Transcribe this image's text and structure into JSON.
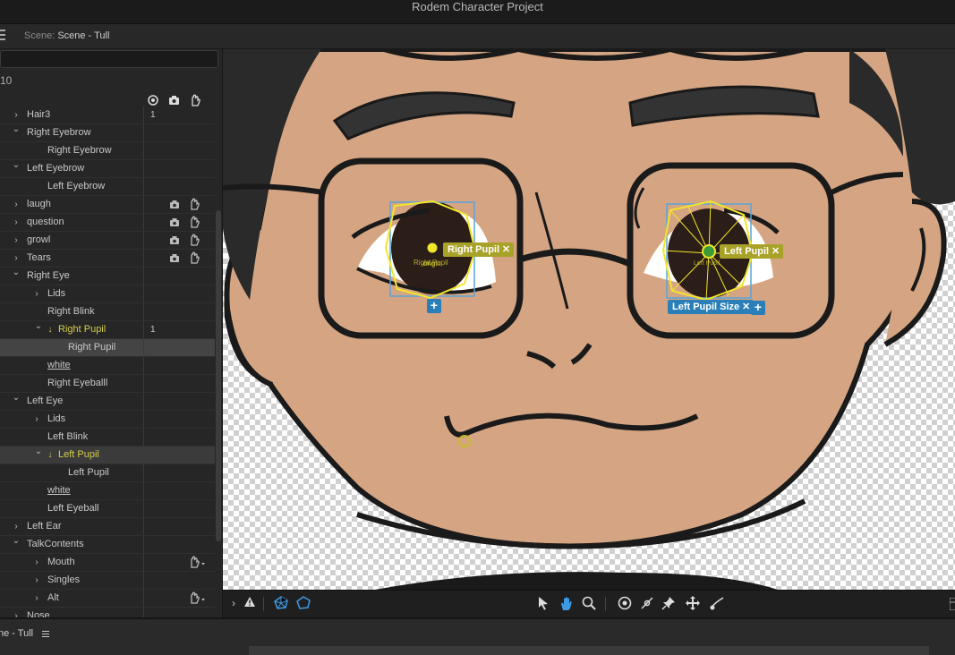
{
  "window": {
    "title": "Rodem Character Project"
  },
  "scene": {
    "label": "Scene:",
    "name": "Scene - Tull"
  },
  "panel": {
    "count": "10",
    "columns": [
      "record-icon",
      "camera-lock-icon",
      "hand-icon"
    ],
    "rows": [
      {
        "label": "Hair3",
        "indent": 30,
        "chev": "right",
        "num": "1"
      },
      {
        "label": "Right Eyebrow",
        "indent": 30,
        "chev": "down"
      },
      {
        "label": "Right Eyebrow",
        "indent": 53
      },
      {
        "label": "Left Eyebrow",
        "indent": 30,
        "chev": "down"
      },
      {
        "label": "Left Eyebrow",
        "indent": 53
      },
      {
        "label": "laugh",
        "indent": 30,
        "chev": "right",
        "icons": true
      },
      {
        "label": "question",
        "indent": 30,
        "chev": "right",
        "icons": true
      },
      {
        "label": "growl",
        "indent": 30,
        "chev": "right",
        "icons": true
      },
      {
        "label": "Tears",
        "indent": 30,
        "chev": "right",
        "icons": true
      },
      {
        "label": "Right Eye",
        "indent": 30,
        "chev": "down"
      },
      {
        "label": "Lids",
        "indent": 53,
        "chev": "right"
      },
      {
        "label": "Right Blink",
        "indent": 53
      },
      {
        "label": "Right Pupil",
        "indent": 65,
        "chev": "down",
        "yellow": true,
        "num": "1",
        "arrow": true
      },
      {
        "label": "Right Pupil",
        "indent": 76,
        "sel": true
      },
      {
        "label": "white",
        "indent": 53,
        "underline": true
      },
      {
        "label": "Right Eyeballl",
        "indent": 53
      },
      {
        "label": "Left Eye",
        "indent": 30,
        "chev": "down"
      },
      {
        "label": "Lids",
        "indent": 53,
        "chev": "right"
      },
      {
        "label": "Left Blink",
        "indent": 53
      },
      {
        "label": "Left Pupil",
        "indent": 65,
        "chev": "down",
        "yellow": true,
        "arrow": true,
        "sel2": true
      },
      {
        "label": "Left Pupil",
        "indent": 76
      },
      {
        "label": "white",
        "indent": 53,
        "underline": true
      },
      {
        "label": "Left Eyeball",
        "indent": 53
      },
      {
        "label": "Left Ear",
        "indent": 30,
        "chev": "right"
      },
      {
        "label": "TalkContents",
        "indent": 30,
        "chev": "down"
      },
      {
        "label": "Mouth",
        "indent": 53,
        "chev": "right",
        "handdrop": true
      },
      {
        "label": "Singles",
        "indent": 53,
        "chev": "right"
      },
      {
        "label": "Alt",
        "indent": 53,
        "chev": "right",
        "handdrop": true
      },
      {
        "label": "Nose",
        "indent": 30,
        "chev": "right"
      }
    ]
  },
  "canvas": {
    "tags": {
      "right_pupil": "Right Pupil",
      "left_pupil": "Left Pupil",
      "left_pupil_size": "Left Pupil Size",
      "right_pupil_small": "Right Pupil",
      "left_pupil_small": "Left Pupil",
      "origin": "origin",
      "close": "✕",
      "plus": "+"
    }
  },
  "toolbar": {
    "left": [
      "expand-icon",
      "warning-icon",
      "mesh-icon",
      "outline-icon"
    ],
    "center": [
      "select-arrow-icon",
      "hand-pan-icon",
      "zoom-icon",
      "origin-icon",
      "pin-stick-icon",
      "pin-icon",
      "move-icon",
      "dangle-icon"
    ]
  },
  "bottom": {
    "label": "ne - Tull"
  },
  "colors": {
    "accent_yellow": "#a9a229",
    "accent_blue": "#2b7fb8",
    "skin": "#d5a583"
  }
}
